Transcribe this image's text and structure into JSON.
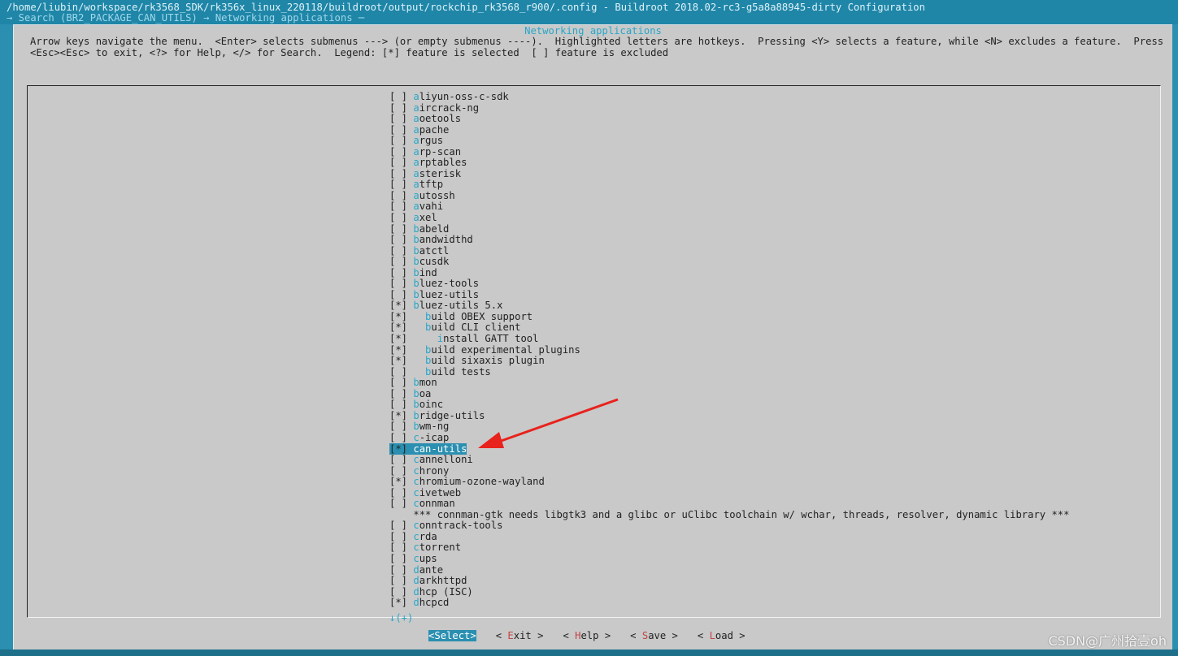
{
  "titlebar": {
    "path": "/home/liubin/workspace/rk3568_SDK/rk356x_linux_220118/buildroot/output/rockchip_rk3568_r900/.config - Buildroot 2018.02-rc3-g5a8a88945-dirty Configuration",
    "search": "→ Search (BR2_PACKAGE_CAN_UTILS) → Networking applications ─"
  },
  "dialog": {
    "title": "Networking applications",
    "help_line1": "Arrow keys navigate the menu.  <Enter> selects submenus ---> (or empty submenus ----).  Highlighted letters are hotkeys.  Pressing <Y> selects a feature, while <N> excludes a feature.  Press",
    "help_line2": "<Esc><Esc> to exit, <?> for Help, </> for Search.  Legend: [*] feature is selected  [ ] feature is excluded"
  },
  "items": [
    {
      "check": "[ ]",
      "indent": "",
      "hot": "a",
      "rest": "liyun-oss-c-sdk"
    },
    {
      "check": "[ ]",
      "indent": "",
      "hot": "a",
      "rest": "ircrack-ng"
    },
    {
      "check": "[ ]",
      "indent": "",
      "hot": "a",
      "rest": "oetools"
    },
    {
      "check": "[ ]",
      "indent": "",
      "hot": "a",
      "rest": "pache"
    },
    {
      "check": "[ ]",
      "indent": "",
      "hot": "a",
      "rest": "rgus"
    },
    {
      "check": "[ ]",
      "indent": "",
      "hot": "a",
      "rest": "rp-scan"
    },
    {
      "check": "[ ]",
      "indent": "",
      "hot": "a",
      "rest": "rptables"
    },
    {
      "check": "[ ]",
      "indent": "",
      "hot": "a",
      "rest": "sterisk"
    },
    {
      "check": "[ ]",
      "indent": "",
      "hot": "a",
      "rest": "tftp"
    },
    {
      "check": "[ ]",
      "indent": "",
      "hot": "a",
      "rest": "utossh"
    },
    {
      "check": "[ ]",
      "indent": "",
      "hot": "a",
      "rest": "vahi"
    },
    {
      "check": "[ ]",
      "indent": "",
      "hot": "a",
      "rest": "xel"
    },
    {
      "check": "[ ]",
      "indent": "",
      "hot": "b",
      "rest": "abeld"
    },
    {
      "check": "[ ]",
      "indent": "",
      "hot": "b",
      "rest": "andwidthd"
    },
    {
      "check": "[ ]",
      "indent": "",
      "hot": "b",
      "rest": "atctl"
    },
    {
      "check": "[ ]",
      "indent": "",
      "hot": "b",
      "rest": "cusdk"
    },
    {
      "check": "[ ]",
      "indent": "",
      "hot": "b",
      "rest": "ind"
    },
    {
      "check": "[ ]",
      "indent": "",
      "hot": "b",
      "rest": "luez-tools"
    },
    {
      "check": "[ ]",
      "indent": "",
      "hot": "b",
      "rest": "luez-utils"
    },
    {
      "check": "[*]",
      "indent": "",
      "hot": "b",
      "rest": "luez-utils 5.x"
    },
    {
      "check": "[*]",
      "indent": "  ",
      "hot": "b",
      "rest": "uild OBEX support"
    },
    {
      "check": "[*]",
      "indent": "  ",
      "hot": "b",
      "rest": "uild CLI client"
    },
    {
      "check": "[*]",
      "indent": "    ",
      "hot": "i",
      "rest": "nstall GATT tool"
    },
    {
      "check": "[*]",
      "indent": "  ",
      "hot": "b",
      "rest": "uild experimental plugins"
    },
    {
      "check": "[*]",
      "indent": "  ",
      "hot": "b",
      "rest": "uild sixaxis plugin"
    },
    {
      "check": "[ ]",
      "indent": "  ",
      "hot": "b",
      "rest": "uild tests"
    },
    {
      "check": "[ ]",
      "indent": "",
      "hot": "b",
      "rest": "mon"
    },
    {
      "check": "[ ]",
      "indent": "",
      "hot": "b",
      "rest": "oa"
    },
    {
      "check": "[ ]",
      "indent": "",
      "hot": "b",
      "rest": "oinc"
    },
    {
      "check": "[*]",
      "indent": "",
      "hot": "b",
      "rest": "ridge-utils"
    },
    {
      "check": "[ ]",
      "indent": "",
      "hot": "b",
      "rest": "wm-ng"
    },
    {
      "check": "[ ]",
      "indent": "",
      "hot": "c",
      "rest": "-icap"
    },
    {
      "check": "[*]",
      "indent": "",
      "hot": "c",
      "rest": "an-utils",
      "selected": true
    },
    {
      "check": "[ ]",
      "indent": "",
      "hot": "c",
      "rest": "annelloni"
    },
    {
      "check": "[ ]",
      "indent": "",
      "hot": "c",
      "rest": "hrony"
    },
    {
      "check": "[*]",
      "indent": "",
      "hot": "c",
      "rest": "hromium-ozone-wayland"
    },
    {
      "check": "[ ]",
      "indent": "",
      "hot": "c",
      "rest": "ivetweb"
    },
    {
      "check": "[ ]",
      "indent": "",
      "hot": "c",
      "rest": "onnman"
    },
    {
      "check": "   ",
      "indent": "",
      "hot": "",
      "rest": "*** connman-gtk needs libgtk3 and a glibc or uClibc toolchain w/ wchar, threads, resolver, dynamic library ***"
    },
    {
      "check": "[ ]",
      "indent": "",
      "hot": "c",
      "rest": "onntrack-tools"
    },
    {
      "check": "[ ]",
      "indent": "",
      "hot": "c",
      "rest": "rda"
    },
    {
      "check": "[ ]",
      "indent": "",
      "hot": "c",
      "rest": "torrent"
    },
    {
      "check": "[ ]",
      "indent": "",
      "hot": "c",
      "rest": "ups"
    },
    {
      "check": "[ ]",
      "indent": "",
      "hot": "d",
      "rest": "ante"
    },
    {
      "check": "[ ]",
      "indent": "",
      "hot": "d",
      "rest": "arkhttpd"
    },
    {
      "check": "[ ]",
      "indent": "",
      "hot": "d",
      "rest": "hcp (ISC)"
    },
    {
      "check": "[*]",
      "indent": "",
      "hot": "d",
      "rest": "hcpcd"
    }
  ],
  "more_indicator": "↓(+)",
  "buttons": [
    {
      "pre": "<",
      "hot": "S",
      "rest": "elect>",
      "active": true
    },
    {
      "pre": "< ",
      "hot": "E",
      "rest": "xit >",
      "active": false
    },
    {
      "pre": "< ",
      "hot": "H",
      "rest": "elp >",
      "active": false
    },
    {
      "pre": "< ",
      "hot": "S",
      "rest": "ave >",
      "active": false
    },
    {
      "pre": "< ",
      "hot": "L",
      "rest": "oad >",
      "active": false
    }
  ],
  "annotation": {
    "icon": "red-arrow-icon",
    "color": "#e8221c"
  },
  "watermark": "CSDN@广州拾壹oh"
}
